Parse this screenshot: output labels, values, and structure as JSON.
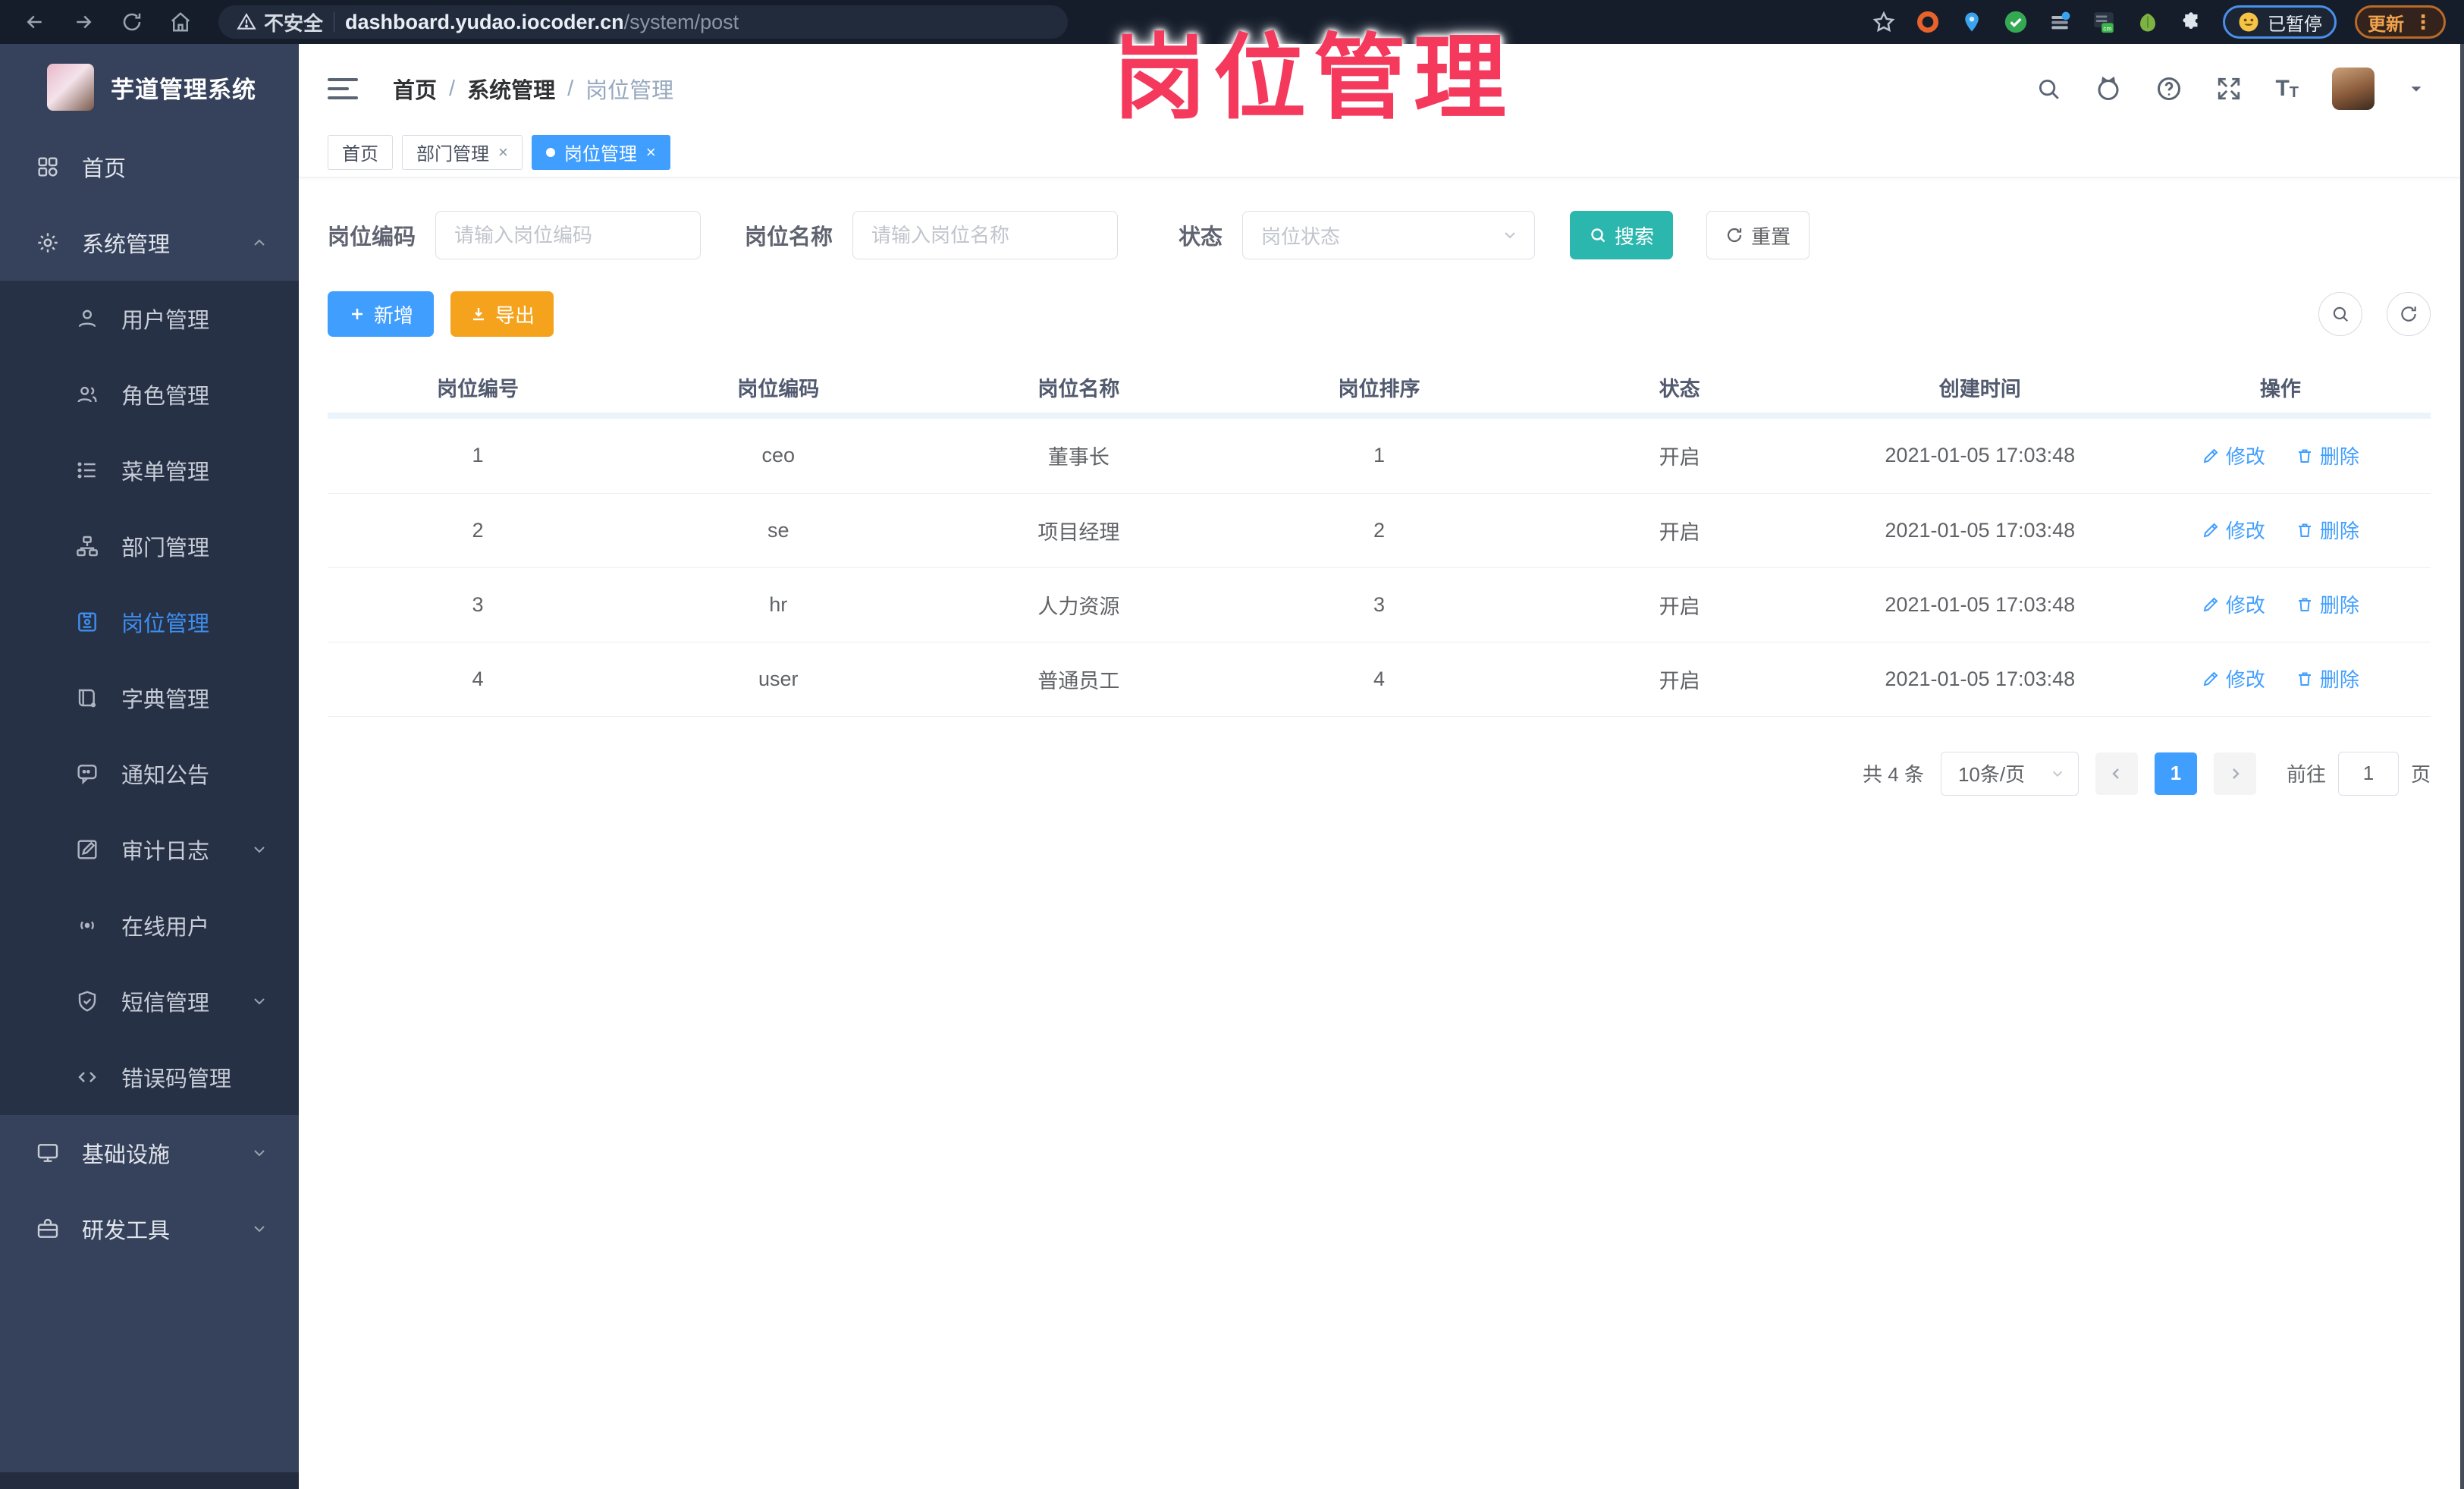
{
  "browser": {
    "security_label": "不安全",
    "url_host": "dashboard.yudao.iocoder.cn",
    "url_path": "/system/post",
    "paused_badge": "已暂停",
    "update_button": "更新"
  },
  "watermark": "岗位管理",
  "sidebar": {
    "app_title": "芋道管理系统",
    "items": [
      {
        "label": "首页",
        "icon": "home",
        "type": "top"
      },
      {
        "label": "系统管理",
        "icon": "gear",
        "type": "top",
        "chevron": "up"
      },
      {
        "label": "用户管理",
        "icon": "user",
        "type": "sub"
      },
      {
        "label": "角色管理",
        "icon": "role",
        "type": "sub"
      },
      {
        "label": "菜单管理",
        "icon": "list",
        "type": "sub"
      },
      {
        "label": "部门管理",
        "icon": "tree",
        "type": "sub"
      },
      {
        "label": "岗位管理",
        "icon": "badge",
        "type": "sub",
        "active": true
      },
      {
        "label": "字典管理",
        "icon": "book",
        "type": "sub"
      },
      {
        "label": "通知公告",
        "icon": "chat",
        "type": "sub"
      },
      {
        "label": "审计日志",
        "icon": "editlog",
        "type": "sub",
        "chevron": "down"
      },
      {
        "label": "在线用户",
        "icon": "online",
        "type": "sub"
      },
      {
        "label": "短信管理",
        "icon": "shield",
        "type": "sub",
        "chevron": "down"
      },
      {
        "label": "错误码管理",
        "icon": "code",
        "type": "sub"
      },
      {
        "label": "基础设施",
        "icon": "monitor",
        "type": "top",
        "chevron": "down"
      },
      {
        "label": "研发工具",
        "icon": "tools",
        "type": "top",
        "chevron": "down"
      }
    ]
  },
  "header": {
    "breadcrumb": [
      "首页",
      "系统管理",
      "岗位管理"
    ]
  },
  "tags": [
    {
      "label": "首页",
      "closable": false,
      "active": false
    },
    {
      "label": "部门管理",
      "closable": true,
      "active": false
    },
    {
      "label": "岗位管理",
      "closable": true,
      "active": true
    }
  ],
  "filters": {
    "code_label": "岗位编码",
    "code_placeholder": "请输入岗位编码",
    "name_label": "岗位名称",
    "name_placeholder": "请输入岗位名称",
    "status_label": "状态",
    "status_placeholder": "岗位状态",
    "search_label": "搜索",
    "reset_label": "重置"
  },
  "toolbar": {
    "add_label": "新增",
    "export_label": "导出"
  },
  "table": {
    "columns": [
      "岗位编号",
      "岗位编码",
      "岗位名称",
      "岗位排序",
      "状态",
      "创建时间",
      "操作"
    ],
    "rows": [
      {
        "id": "1",
        "code": "ceo",
        "name": "董事长",
        "sort": "1",
        "status": "开启",
        "created": "2021-01-05 17:03:48"
      },
      {
        "id": "2",
        "code": "se",
        "name": "项目经理",
        "sort": "2",
        "status": "开启",
        "created": "2021-01-05 17:03:48"
      },
      {
        "id": "3",
        "code": "hr",
        "name": "人力资源",
        "sort": "3",
        "status": "开启",
        "created": "2021-01-05 17:03:48"
      },
      {
        "id": "4",
        "code": "user",
        "name": "普通员工",
        "sort": "4",
        "status": "开启",
        "created": "2021-01-05 17:03:48"
      }
    ],
    "actions": {
      "edit": "修改",
      "delete": "删除"
    }
  },
  "pagination": {
    "total_label": "共 4 条",
    "page_size_label": "10条/页",
    "current_page": "1",
    "goto_label": "前往",
    "goto_value": "1",
    "unit_label": "页"
  },
  "icons": {
    "close_glyph": "×",
    "dots_glyph": "⋮",
    "caret_glyph": "▾"
  }
}
